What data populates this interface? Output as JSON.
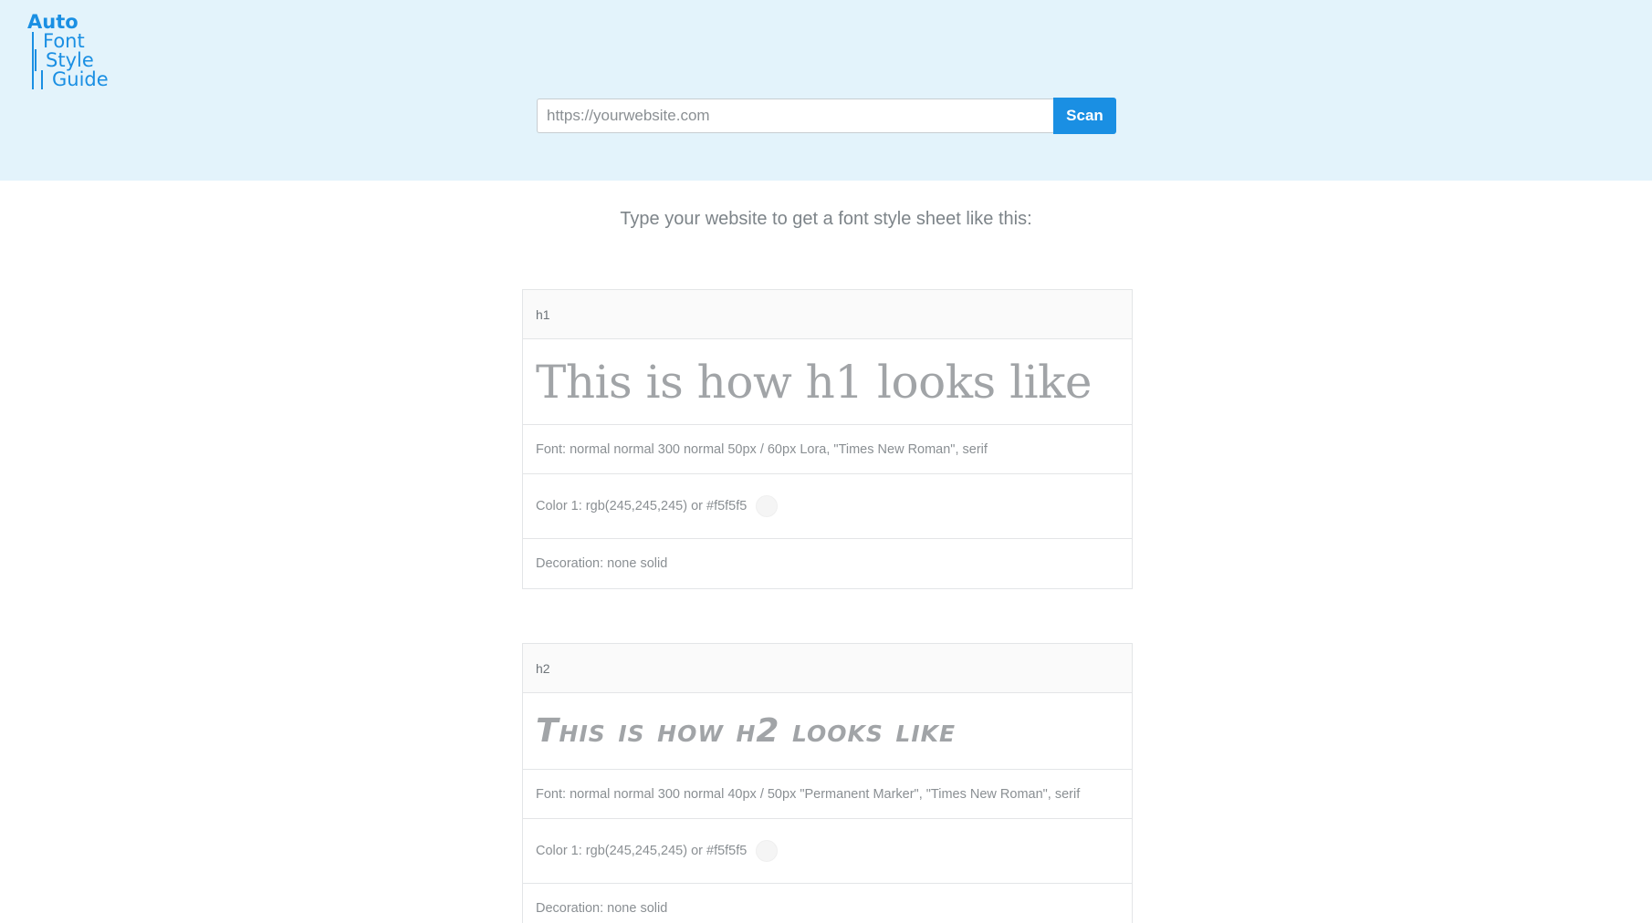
{
  "logo": {
    "line1": "Auto",
    "line2": "Font",
    "line3": "Style",
    "line4": "Guide"
  },
  "search": {
    "placeholder": "https://yourwebsite.com",
    "button_label": "Scan"
  },
  "intro": "Type your website to get a font style sheet like this:",
  "cards": [
    {
      "tag": "h1",
      "sample": "This is how h1 looks like",
      "font": "Font: normal normal 300 normal 50px / 60px Lora, \"Times New Roman\", serif",
      "color_text": "Color 1: rgb(245,245,245) or #f5f5f5",
      "color_swatch": "#f5f5f5",
      "decoration": "Decoration: none solid"
    },
    {
      "tag": "h2",
      "sample": "This is how h2 looks like",
      "font": "Font: normal normal 300 normal 40px / 50px \"Permanent Marker\", \"Times New Roman\", serif",
      "color_text": "Color 1: rgb(245,245,245) or #f5f5f5",
      "color_swatch": "#f5f5f5",
      "decoration": "Decoration: none solid"
    }
  ],
  "colors": {
    "accent": "#1a8fe3",
    "header_bg": "#e3f3fb"
  }
}
